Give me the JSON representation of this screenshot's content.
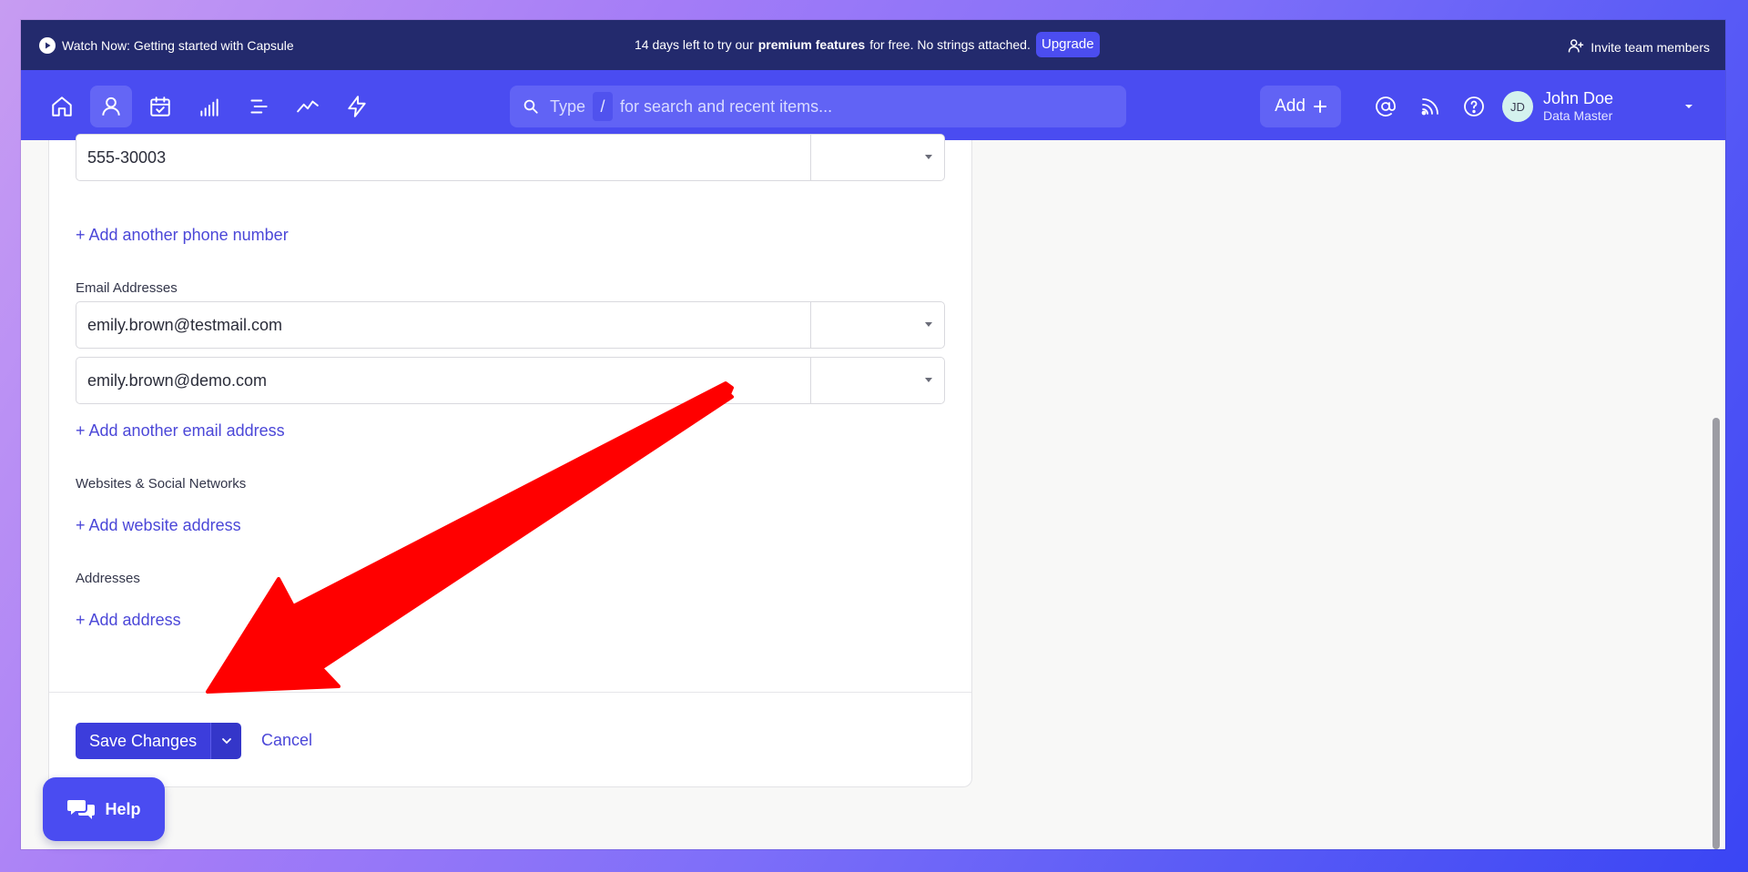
{
  "notice": {
    "watch_label": "Watch Now: Getting started with Capsule",
    "trial_prefix": "14 days left to try our",
    "trial_bold": "premium features",
    "trial_suffix": "for free. No strings attached.",
    "upgrade_label": "Upgrade",
    "invite_label": "Invite team members"
  },
  "nav": {
    "icons": [
      "home-icon",
      "person-icon",
      "calendar-icon",
      "bars-icon",
      "list-icon",
      "trend-icon",
      "bolt-icon"
    ],
    "active": "person-icon"
  },
  "search": {
    "prefix": "Type",
    "key": "/",
    "placeholder": "for search and recent items..."
  },
  "header": {
    "add_label": "Add"
  },
  "user": {
    "initials": "JD",
    "name": "John Doe",
    "role": "Data Master"
  },
  "form": {
    "phone_value": "555-30003",
    "add_phone_link": "+ Add another phone number",
    "email_label": "Email Addresses",
    "emails": [
      "emily.brown@testmail.com",
      "emily.brown@demo.com"
    ],
    "add_email_link": "+ Add another email address",
    "websites_label": "Websites & Social Networks",
    "add_website_link": "+ Add website address",
    "addresses_label": "Addresses",
    "add_address_link": "+ Add address",
    "save_label": "Save Changes",
    "cancel_label": "Cancel"
  },
  "help": {
    "label": "Help"
  },
  "colors": {
    "brand": "#4a4cf1",
    "notice_bg": "#232a6d",
    "link": "#4b47d8",
    "annotation_arrow": "#ff0000"
  }
}
